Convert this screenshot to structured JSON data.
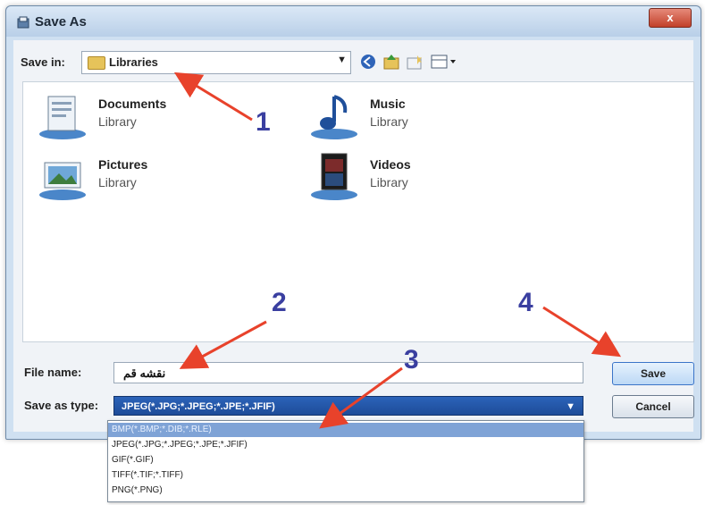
{
  "window": {
    "title": "Save As",
    "close_label": "x"
  },
  "save_in": {
    "label": "Save in:",
    "value": "Libraries"
  },
  "toolbar": {
    "icons": [
      "back-icon",
      "up-folder-icon",
      "new-folder-icon",
      "view-menu-icon"
    ]
  },
  "items": [
    {
      "name": "Documents",
      "subtitle": "Library"
    },
    {
      "name": "Music",
      "subtitle": "Library"
    },
    {
      "name": "Pictures",
      "subtitle": "Library"
    },
    {
      "name": "Videos",
      "subtitle": "Library"
    }
  ],
  "file_name": {
    "label": "File name:",
    "value": "نقشه قم"
  },
  "save_type": {
    "label": "Save as type:",
    "value": "JPEG(*.JPG;*.JPEG;*.JPE;*.JFIF)",
    "options": [
      "BMP(*.BMP;*.DIB;*.RLE)",
      "JPEG(*.JPG;*.JPEG;*.JPE;*.JFIF)",
      "GIF(*.GIF)",
      "TIFF(*.TIF;*.TIFF)",
      "PNG(*.PNG)"
    ]
  },
  "buttons": {
    "save": "Save",
    "cancel": "Cancel"
  },
  "annotations": [
    "1",
    "2",
    "3",
    "4"
  ],
  "colors": {
    "arrow": "#e8422b",
    "annotation": "#3a3fa0",
    "selected": "#2b63b9"
  }
}
